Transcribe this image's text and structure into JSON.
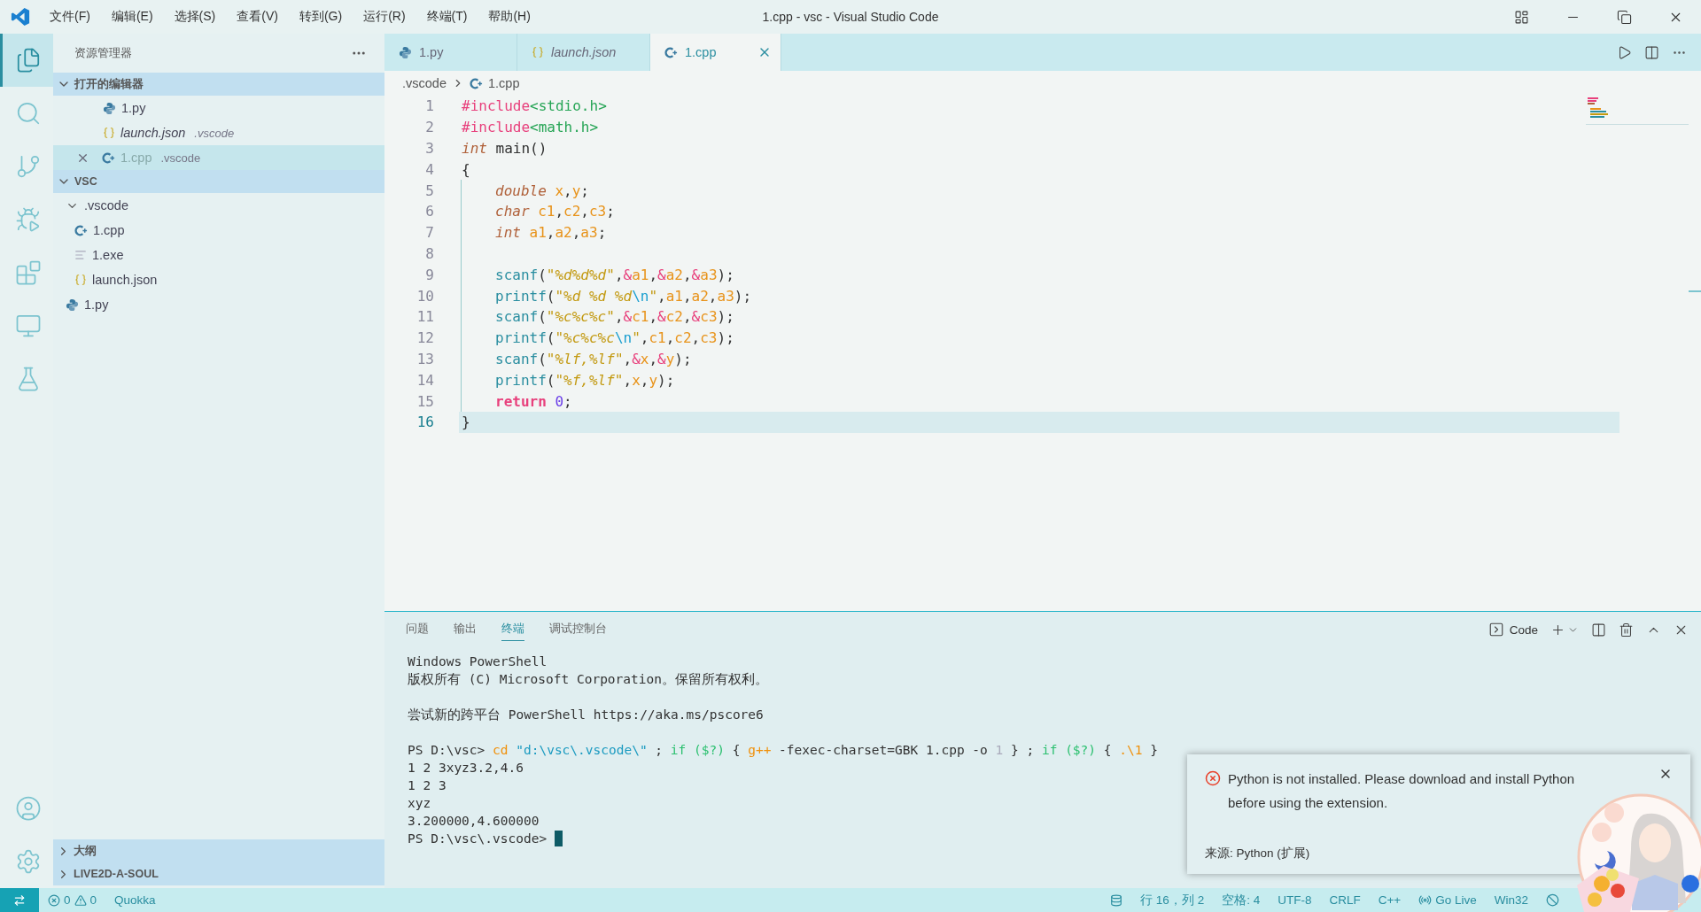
{
  "window": {
    "title": "1.cpp - vsc - Visual Studio Code"
  },
  "menu": [
    "文件(F)",
    "编辑(E)",
    "选择(S)",
    "查看(V)",
    "转到(G)",
    "运行(R)",
    "终端(T)",
    "帮助(H)"
  ],
  "window_controls": [
    {
      "kind": "layout"
    },
    {
      "kind": "minimize"
    },
    {
      "kind": "restore"
    },
    {
      "kind": "close"
    }
  ],
  "activity_bar": {
    "top": [
      {
        "kind": "files",
        "selected": true
      },
      {
        "kind": "search",
        "selected": false
      },
      {
        "kind": "source-control",
        "selected": false
      },
      {
        "kind": "run-debug",
        "selected": false
      },
      {
        "kind": "extensions",
        "selected": false
      },
      {
        "kind": "remote",
        "selected": false
      },
      {
        "kind": "testing",
        "selected": false
      }
    ],
    "bottom": [
      {
        "kind": "account"
      },
      {
        "kind": "settings"
      }
    ]
  },
  "sidebar": {
    "title": "资源管理器",
    "open_editors": {
      "label": "打开的编辑器",
      "expanded": true,
      "items": [
        {
          "name": "1.py",
          "kind": "python",
          "preview": false,
          "selected": false
        },
        {
          "name": "launch.json",
          "folder": ".vscode",
          "kind": "json",
          "preview": true,
          "selected": false
        },
        {
          "name": "1.cpp",
          "folder": ".vscode",
          "kind": "cpp",
          "preview": false,
          "selected": true
        }
      ]
    },
    "folder": {
      "label": "VSC",
      "expanded": true,
      "children": [
        {
          "name": ".vscode",
          "kind": "folder",
          "expanded": true,
          "children": [
            {
              "name": "1.cpp",
              "kind": "cpp"
            },
            {
              "name": "1.exe",
              "kind": "file"
            },
            {
              "name": "launch.json",
              "kind": "json"
            }
          ]
        },
        {
          "name": "1.py",
          "kind": "python"
        }
      ]
    },
    "bottom_sections": [
      {
        "label": "大纲",
        "expanded": false
      },
      {
        "label": "LIVE2D-A-SOUL",
        "expanded": false
      }
    ]
  },
  "editor": {
    "tabs": [
      {
        "label": "1.py",
        "kind": "python",
        "preview": false,
        "selected": false
      },
      {
        "label": "launch.json",
        "kind": "json",
        "preview": true,
        "selected": false
      },
      {
        "label": "1.cpp",
        "kind": "cpp",
        "preview": false,
        "selected": true
      }
    ],
    "tab_actions": [
      {
        "kind": "run"
      },
      {
        "kind": "split"
      },
      {
        "kind": "more"
      }
    ],
    "breadcrumb": [
      ".vscode",
      "1.cpp"
    ],
    "lines": [
      {
        "number": "1",
        "tokens": [
          {
            "text": "#include",
            "kind": "pre"
          },
          {
            "text": "<stdio.h>",
            "kind": "inc"
          }
        ]
      },
      {
        "number": "2",
        "tokens": [
          {
            "text": "#include",
            "kind": "pre"
          },
          {
            "text": "<math.h>",
            "kind": "inc"
          }
        ]
      },
      {
        "number": "3",
        "tokens": [
          {
            "text": "int",
            "kind": "type"
          },
          {
            "text": " main()",
            "kind": "plain"
          }
        ]
      },
      {
        "number": "4",
        "tokens": [
          {
            "text": "{",
            "kind": "plain"
          }
        ]
      },
      {
        "number": "5",
        "indented": true,
        "tokens": [
          {
            "text": "double",
            "kind": "type"
          },
          {
            "text": " x",
            "kind": "var"
          },
          {
            "text": ",",
            "kind": "plain"
          },
          {
            "text": "y",
            "kind": "var"
          },
          {
            "text": ";",
            "kind": "plain"
          }
        ]
      },
      {
        "number": "6",
        "indented": true,
        "tokens": [
          {
            "text": "char",
            "kind": "type"
          },
          {
            "text": " c1",
            "kind": "var"
          },
          {
            "text": ",",
            "kind": "plain"
          },
          {
            "text": "c2",
            "kind": "var"
          },
          {
            "text": ",",
            "kind": "plain"
          },
          {
            "text": "c3",
            "kind": "var"
          },
          {
            "text": ";",
            "kind": "plain"
          }
        ]
      },
      {
        "number": "7",
        "indented": true,
        "tokens": [
          {
            "text": "int",
            "kind": "type"
          },
          {
            "text": " a1",
            "kind": "var"
          },
          {
            "text": ",",
            "kind": "plain"
          },
          {
            "text": "a2",
            "kind": "var"
          },
          {
            "text": ",",
            "kind": "plain"
          },
          {
            "text": "a3",
            "kind": "var"
          },
          {
            "text": ";",
            "kind": "plain"
          }
        ]
      },
      {
        "number": "8",
        "indented": true
      },
      {
        "number": "9",
        "indented": true,
        "tokens": [
          {
            "text": "scanf",
            "kind": "fn"
          },
          {
            "text": "(",
            "kind": "plain"
          },
          {
            "text": "\"%d%d%d\"",
            "kind": "str"
          },
          {
            "text": ",",
            "kind": "plain"
          },
          {
            "text": "&",
            "kind": "amp"
          },
          {
            "text": "a1",
            "kind": "var"
          },
          {
            "text": ",",
            "kind": "plain"
          },
          {
            "text": "&",
            "kind": "amp"
          },
          {
            "text": "a2",
            "kind": "var"
          },
          {
            "text": ",",
            "kind": "plain"
          },
          {
            "text": "&",
            "kind": "amp"
          },
          {
            "text": "a3",
            "kind": "var"
          },
          {
            "text": ");",
            "kind": "plain"
          }
        ]
      },
      {
        "number": "10",
        "indented": true,
        "tokens": [
          {
            "text": "printf",
            "kind": "fn"
          },
          {
            "text": "(",
            "kind": "plain"
          },
          {
            "text": "\"%d %d %d",
            "kind": "str"
          },
          {
            "text": "\\n",
            "kind": "esc"
          },
          {
            "text": "\"",
            "kind": "str"
          },
          {
            "text": ",",
            "kind": "plain"
          },
          {
            "text": "a1",
            "kind": "var"
          },
          {
            "text": ",",
            "kind": "plain"
          },
          {
            "text": "a2",
            "kind": "var"
          },
          {
            "text": ",",
            "kind": "plain"
          },
          {
            "text": "a3",
            "kind": "var"
          },
          {
            "text": ");",
            "kind": "plain"
          }
        ]
      },
      {
        "number": "11",
        "indented": true,
        "tokens": [
          {
            "text": "scanf",
            "kind": "fn"
          },
          {
            "text": "(",
            "kind": "plain"
          },
          {
            "text": "\"%c%c%c\"",
            "kind": "str"
          },
          {
            "text": ",",
            "kind": "plain"
          },
          {
            "text": "&",
            "kind": "amp"
          },
          {
            "text": "c1",
            "kind": "var"
          },
          {
            "text": ",",
            "kind": "plain"
          },
          {
            "text": "&",
            "kind": "amp"
          },
          {
            "text": "c2",
            "kind": "var"
          },
          {
            "text": ",",
            "kind": "plain"
          },
          {
            "text": "&",
            "kind": "amp"
          },
          {
            "text": "c3",
            "kind": "var"
          },
          {
            "text": ");",
            "kind": "plain"
          }
        ]
      },
      {
        "number": "12",
        "indented": true,
        "tokens": [
          {
            "text": "printf",
            "kind": "fn"
          },
          {
            "text": "(",
            "kind": "plain"
          },
          {
            "text": "\"%c%c%c",
            "kind": "str"
          },
          {
            "text": "\\n",
            "kind": "esc"
          },
          {
            "text": "\"",
            "kind": "str"
          },
          {
            "text": ",",
            "kind": "plain"
          },
          {
            "text": "c1",
            "kind": "var"
          },
          {
            "text": ",",
            "kind": "plain"
          },
          {
            "text": "c2",
            "kind": "var"
          },
          {
            "text": ",",
            "kind": "plain"
          },
          {
            "text": "c3",
            "kind": "var"
          },
          {
            "text": ");",
            "kind": "plain"
          }
        ]
      },
      {
        "number": "13",
        "indented": true,
        "tokens": [
          {
            "text": "scanf",
            "kind": "fn"
          },
          {
            "text": "(",
            "kind": "plain"
          },
          {
            "text": "\"%lf,%lf\"",
            "kind": "str"
          },
          {
            "text": ",",
            "kind": "plain"
          },
          {
            "text": "&",
            "kind": "amp"
          },
          {
            "text": "x",
            "kind": "var"
          },
          {
            "text": ",",
            "kind": "plain"
          },
          {
            "text": "&",
            "kind": "amp"
          },
          {
            "text": "y",
            "kind": "var"
          },
          {
            "text": ");",
            "kind": "plain"
          }
        ]
      },
      {
        "number": "14",
        "indented": true,
        "tokens": [
          {
            "text": "printf",
            "kind": "fn"
          },
          {
            "text": "(",
            "kind": "plain"
          },
          {
            "text": "\"%f,%lf\"",
            "kind": "str"
          },
          {
            "text": ",",
            "kind": "plain"
          },
          {
            "text": "x",
            "kind": "var"
          },
          {
            "text": ",",
            "kind": "plain"
          },
          {
            "text": "y",
            "kind": "var"
          },
          {
            "text": ");",
            "kind": "plain"
          }
        ]
      },
      {
        "number": "15",
        "indented": true,
        "tokens": [
          {
            "text": "return",
            "kind": "kw"
          },
          {
            "text": " 0",
            "kind": "num"
          },
          {
            "text": ";",
            "kind": "plain"
          }
        ]
      },
      {
        "number": "16",
        "current": true,
        "tokens": [
          {
            "text": "}",
            "kind": "plain"
          }
        ]
      }
    ]
  },
  "panel": {
    "tabs": [
      {
        "label": "问题",
        "selected": false
      },
      {
        "label": "输出",
        "selected": false
      },
      {
        "label": "终端",
        "selected": true
      },
      {
        "label": "调试控制台",
        "selected": false
      }
    ],
    "actions": [
      {
        "kind": "terminal",
        "label": "Code"
      },
      {
        "kind": "add"
      },
      {
        "kind": "dropdown"
      },
      {
        "kind": "split"
      },
      {
        "kind": "trash"
      },
      {
        "kind": "maximize"
      },
      {
        "kind": "close"
      }
    ],
    "terminal": [
      {
        "lines": [
          {
            "tokens": [
              {
                "text": "Windows PowerShell",
                "kind": "plain"
              }
            ]
          },
          {
            "tokens": [
              {
                "text": "版权所有 (C) Microsoft Corporation。保留所有权利。",
                "kind": "plain"
              }
            ]
          }
        ]
      },
      {
        "lines": [
          {
            "tokens": [
              {
                "text": "尝试新的跨平台 PowerShell https://aka.ms/pscore6",
                "kind": "plain"
              }
            ]
          }
        ]
      },
      {
        "lines": [
          {
            "tokens": [
              {
                "text": "PS D:\\vsc> ",
                "kind": "plain"
              },
              {
                "text": "cd",
                "kind": "cmd"
              },
              {
                "text": " \"d:\\vsc\\.vscode\\\"",
                "kind": "str"
              },
              {
                "text": " ; ",
                "kind": "plain"
              },
              {
                "text": "if",
                "kind": "kw"
              },
              {
                "text": " ($?)",
                "kind": "kw"
              },
              {
                "text": " { ",
                "kind": "plain"
              },
              {
                "text": "g++",
                "kind": "cmd"
              },
              {
                "text": " -fexec-charset=GBK 1.cpp -o ",
                "kind": "plain"
              },
              {
                "text": "1",
                "kind": "dim"
              },
              {
                "text": " } ; ",
                "kind": "plain"
              },
              {
                "text": "if",
                "kind": "kw"
              },
              {
                "text": " ($?)",
                "kind": "kw"
              },
              {
                "text": " { ",
                "kind": "plain"
              },
              {
                "text": ".\\1",
                "kind": "cmd"
              },
              {
                "text": " }",
                "kind": "plain"
              }
            ]
          },
          {
            "tokens": [
              {
                "text": "1 2 3xyz3.2,4.6",
                "kind": "plain"
              }
            ]
          },
          {
            "tokens": [
              {
                "text": "1 2 3",
                "kind": "plain"
              }
            ]
          },
          {
            "tokens": [
              {
                "text": "xyz",
                "kind": "plain"
              }
            ]
          },
          {
            "tokens": [
              {
                "text": "3.200000,4.600000",
                "kind": "plain"
              }
            ]
          },
          {
            "tokens": [
              {
                "text": "PS D:\\vsc\\.vscode> ",
                "kind": "plain"
              }
            ],
            "cursor": true
          }
        ]
      }
    ]
  },
  "notification": {
    "message": "Python is not installed. Please download and install Python before using the extension.",
    "source": "来源: Python (扩展)"
  },
  "status_bar": {
    "left": [
      {
        "kind": "remote"
      },
      {
        "kind": "problems",
        "errors": "0",
        "warnings": "0"
      },
      {
        "kind": "text",
        "label": "Quokka"
      }
    ],
    "right": [
      {
        "kind": "database"
      },
      {
        "kind": "text",
        "label": "行 16，列 2"
      },
      {
        "kind": "text",
        "label": "空格: 4"
      },
      {
        "kind": "text",
        "label": "UTF-8"
      },
      {
        "kind": "text",
        "label": "CRLF"
      },
      {
        "kind": "text",
        "label": "C++"
      },
      {
        "kind": "live",
        "label": "Go Live"
      },
      {
        "kind": "text",
        "label": "Win32"
      },
      {
        "kind": "blocked"
      }
    ]
  },
  "overlay": {
    "kind": "picture"
  }
}
